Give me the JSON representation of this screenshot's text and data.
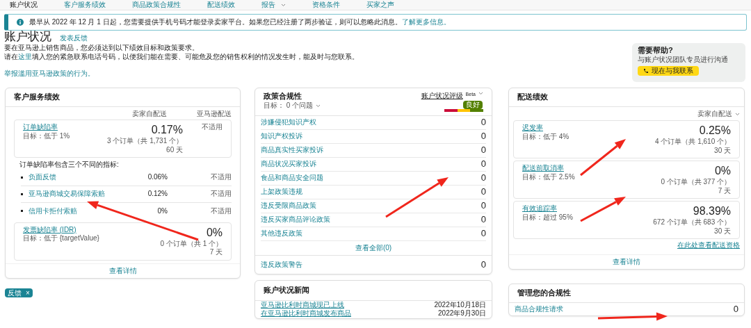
{
  "nav": [
    {
      "label": "账户状况",
      "dropdown": false
    },
    {
      "label": "客户服务绩效",
      "dropdown": false
    },
    {
      "label": "商品政策合规性",
      "dropdown": false
    },
    {
      "label": "配送绩效",
      "dropdown": false
    },
    {
      "label": "报告",
      "dropdown": true
    },
    {
      "label": "资格条件",
      "dropdown": false
    },
    {
      "label": "买家之声",
      "dropdown": false
    }
  ],
  "banner": {
    "text": "最早从 2022 年 12 月 1 日起，您需要提供手机号码才能登录卖家平台。如果您已经注册了两步验证，则可以忽略此消息。",
    "link": "了解更多信息。"
  },
  "header": {
    "title": "账户状况",
    "feedback_link": "发表反馈",
    "line_1": "要在亚马逊上销售商品，您必须达到以下绩效目标和政策要求。",
    "line_2": {
      "before": "请在",
      "link": "这里",
      "after": "填入您的紧急联系电话号码，以便我们能在需要、可能危及您的销售权利的情况发生时，能及时与您联系。"
    },
    "report_link": "举报滥用亚马逊政策的行为。"
  },
  "help": {
    "title": "需要帮助?",
    "subtitle": "与账户状况团队专员进行沟通",
    "button": "现在与我联系"
  },
  "customer_service": {
    "title": "客户服务绩效",
    "columns": [
      "卖家自配送",
      "亚马逊配送"
    ],
    "main": {
      "name": "订单缺陷率",
      "target": "目标：低于 1%",
      "value": "0.17%",
      "detail": "3 个订单（共 1,731 个）",
      "period": "60 天",
      "afn": "不适用"
    },
    "note": "订单缺陷率包含三个不同的指标:",
    "sub_metrics": [
      {
        "name": "负面反馈",
        "value": "0.06%",
        "afn": "不适用"
      },
      {
        "name": "亚马逊商城交易保障索赔",
        "value": "0.12%",
        "afn": "不适用"
      },
      {
        "name": "信用卡拒付索赔",
        "value": "0%",
        "afn": "不适用"
      }
    ],
    "idr": {
      "name": "发票缺陷率 (IDR)",
      "target": "目标：低于 {targetValue}",
      "value": "0%",
      "detail": "0 个订单（共 1 个）",
      "period": "7 天"
    },
    "footer": "查看详情"
  },
  "policy": {
    "title": "政策合规性",
    "subtitle": "目标： 0 个问题",
    "rating": {
      "label": "账户状况评级",
      "tag": "Beta",
      "status": "良好"
    },
    "rows": [
      {
        "label": "涉嫌侵犯知识产权",
        "count": "0"
      },
      {
        "label": "知识产权投诉",
        "count": "0"
      },
      {
        "label": "商品真实性买家投诉",
        "count": "0"
      },
      {
        "label": "商品状况买家投诉",
        "count": "0"
      },
      {
        "label": "食品和商品安全问题",
        "count": "0"
      },
      {
        "label": "上架政策违规",
        "count": "0"
      },
      {
        "label": "违反受限商品政策",
        "count": "0"
      },
      {
        "label": "违反买家商品评论政策",
        "count": "0"
      },
      {
        "label": "其他违反政策",
        "count": "0"
      }
    ],
    "footer": "查看全部(0)",
    "warning": {
      "label": "违反政策警告",
      "count": "0"
    }
  },
  "news": {
    "title": "账户状况新闻",
    "items": [
      {
        "title": "亚马逊比利时商城现已上线",
        "date": "2022年10月18日"
      },
      {
        "title": "在亚马逊比利时商城发布商品",
        "date": "2022年9月30日"
      }
    ]
  },
  "shipping": {
    "title": "配送绩效",
    "filter": "卖家自配送",
    "metrics": [
      {
        "name": "迟发率",
        "target": "目标：低于 4%",
        "value": "0.25%",
        "detail": "4 个订单（共 1,610 个）",
        "period": "30 天"
      },
      {
        "name": "配送前取消率",
        "target": "目标：低于 2.5%",
        "value": "0%",
        "detail": "0 个订单（共 377 个）",
        "period": "7 天"
      },
      {
        "name": "有效追踪率",
        "target": "目标：超过 95%",
        "value": "98.39%",
        "detail": "672 个订单（共 683 个）",
        "period": "30 天"
      }
    ],
    "link": "在此处查看配送资格",
    "footer": "查看详情"
  },
  "compliance": {
    "title": "管理您的合规性",
    "rows": [
      {
        "label": "商品合规性请求",
        "count": "0"
      }
    ]
  },
  "feedback_tab": {
    "label": "反馈",
    "close": "×"
  }
}
